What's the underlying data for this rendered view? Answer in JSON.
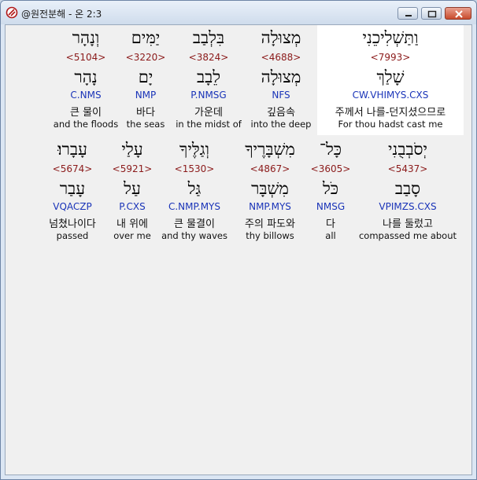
{
  "window": {
    "title": "@원전분해 - 온 2:3"
  },
  "rows": [
    {
      "words": [
        {
          "hebrew": "וְנָהָר",
          "strong": "<5104>",
          "lemma": "נָהָר",
          "morph": "C.NMS",
          "korean": "큰 물이",
          "english": "and the floods",
          "selected": false
        },
        {
          "hebrew": "יַמִּים",
          "strong": "<3220>",
          "lemma": "יָם",
          "morph": "NMP",
          "korean": "바다",
          "english": "the seas",
          "selected": false
        },
        {
          "hebrew": "בִּלְבַב",
          "strong": "<3824>",
          "lemma": "לֵבָב",
          "morph": "P.NMSG",
          "korean": "가운데",
          "english": "in the midst of",
          "selected": false
        },
        {
          "hebrew": "מְצוּלָה",
          "strong": "<4688>",
          "lemma": "מְצוּלָה",
          "morph": "NFS",
          "korean": "깊음속",
          "english": "into the deep",
          "selected": false
        },
        {
          "hebrew": "וַתַּשְׁלִיכֵנִי",
          "strong": "<7993>",
          "lemma": "שָׁלַךְ",
          "morph": "CW.VHIMYS.CXS",
          "korean": "주께서 나를-던지셨으므로",
          "english": "For thou hadst cast me",
          "selected": true
        }
      ]
    },
    {
      "words": [
        {
          "hebrew": "עָבָרוּ׃",
          "strong": "<5674>",
          "lemma": "עָבַר",
          "morph": "VQACZP",
          "korean": "넘쳤나이다",
          "english": "passed",
          "selected": false
        },
        {
          "hebrew": "עָלַי",
          "strong": "<5921>",
          "lemma": "עַל",
          "morph": "P.CXS",
          "korean": "내 위에",
          "english": "over me",
          "selected": false
        },
        {
          "hebrew": "וְגַלֶּיךָ",
          "strong": "<1530>",
          "lemma": "גַּל",
          "morph": "C.NMP.MYS",
          "korean": "큰 물결이",
          "english": "and thy waves",
          "selected": false
        },
        {
          "hebrew": "מִשְׁבָּרֶיךָ",
          "strong": "<4867>",
          "lemma": "מִשְׁבָּר",
          "morph": "NMP.MYS",
          "korean": "주의 파도와",
          "english": "thy billows",
          "selected": false
        },
        {
          "hebrew": "כָּל־",
          "strong": "<3605>",
          "lemma": "כֹּל",
          "morph": "NMSG",
          "korean": "다",
          "english": "all",
          "selected": false
        },
        {
          "hebrew": "יְסֹבְבֻנִי",
          "strong": "<5437>",
          "lemma": "סָבַב",
          "morph": "VPIMZS.CXS",
          "korean": "나를 둘렀고",
          "english": "compassed me about",
          "selected": false
        }
      ]
    }
  ]
}
